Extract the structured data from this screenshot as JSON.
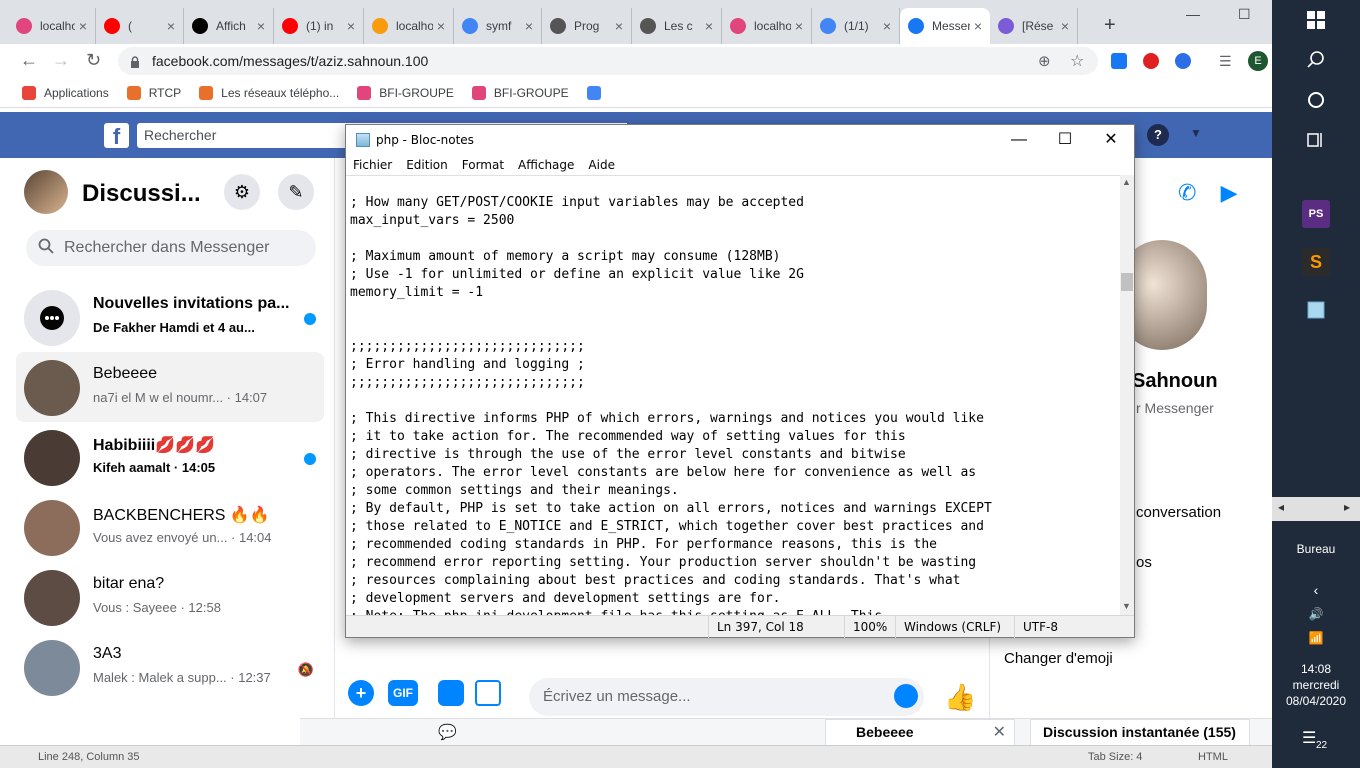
{
  "browser": {
    "tabs": [
      {
        "title": "localhost",
        "icon": "bfi-icon",
        "color": "#e0457b"
      },
      {
        "title": "(",
        "icon": "youtube-icon",
        "color": "#ff0000"
      },
      {
        "title": "Affich",
        "icon": "symfony-icon",
        "color": "#000000"
      },
      {
        "title": "(1) in",
        "icon": "youtube-icon",
        "color": "#ff0000"
      },
      {
        "title": "localhost",
        "icon": "phpmyadmin-icon",
        "color": "#f89c0e"
      },
      {
        "title": "symf",
        "icon": "google-icon",
        "color": "#4285f4"
      },
      {
        "title": "Prog",
        "icon": "w-icon",
        "color": "#555555"
      },
      {
        "title": "Les c",
        "icon": "globe-icon",
        "color": "#555555"
      },
      {
        "title": "localhost",
        "icon": "bfi-icon",
        "color": "#e0457b"
      },
      {
        "title": "(1/1)",
        "icon": "google-icon",
        "color": "#4285f4"
      },
      {
        "title": "Messenger",
        "icon": "facebook-icon",
        "color": "#1877f2"
      },
      {
        "title": "[Rése",
        "icon": "discord-icon",
        "color": "#7b5cd6"
      }
    ],
    "url": "facebook.com/messages/t/aziz.sahnoun.100",
    "profile_letter": "E",
    "bookmarks": [
      {
        "label": "Applications",
        "color": "#e8453c"
      },
      {
        "label": "RTCP",
        "color": "#e8702a"
      },
      {
        "label": "Les réseaux télépho...",
        "color": "#e8702a"
      },
      {
        "label": "BFI-GROUPE",
        "color": "#e0457b"
      },
      {
        "label": "BFI-GROUPE",
        "color": "#e0457b"
      },
      {
        "label": "",
        "color": "#4285f4"
      }
    ]
  },
  "facebook": {
    "search_placeholder": "Rechercher",
    "brand_color": "#4267b2"
  },
  "messenger": {
    "title": "Discussi...",
    "search_placeholder": "Rechercher dans Messenger",
    "conversations": [
      {
        "name": "Nouvelles invitations pa...",
        "snippet": "De Fakher Hamdi et 4 au...",
        "unread": true
      },
      {
        "name": "Bebeeee",
        "snippet": "na7i el M w el noumr...  · 14:07",
        "selected": true
      },
      {
        "name": "Habibiiii💋💋💋",
        "snippet": "Kifeh aamalt  · 14:05",
        "unread": true
      },
      {
        "name": "BACKBENCHERS 🔥🔥",
        "snippet": "Vous avez envoyé un...  · 14:04"
      },
      {
        "name": "bitar ena?",
        "snippet": "Vous : Sayeee  · 12:58"
      },
      {
        "name": "3A3",
        "snippet": "Malek : Malek a supp...  · 12:37",
        "muted": true
      }
    ],
    "composer_placeholder": "Écrivez un message...",
    "composer_gif": "GIF",
    "right_panel": {
      "name": "Sahnoun",
      "subtitle": "r Messenger",
      "conversation_option": "conversation",
      "other_option": "os",
      "emoji_option": "Changer d'emoji"
    }
  },
  "chat_dock": {
    "contact": "Bebeeee",
    "instant": "Discussion instantanée (155)"
  },
  "notepad": {
    "title": "php - Bloc-notes",
    "menu": [
      "Fichier",
      "Edition",
      "Format",
      "Affichage",
      "Aide"
    ],
    "content": "; How many GET/POST/COOKIE input variables may be accepted\nmax_input_vars = 2500\n\n; Maximum amount of memory a script may consume (128MB)\n; Use -1 for unlimited or define an explicit value like 2G\nmemory_limit = -1\n\n\n;;;;;;;;;;;;;;;;;;;;;;;;;;;;;;\n; Error handling and logging ;\n;;;;;;;;;;;;;;;;;;;;;;;;;;;;;;\n\n; This directive informs PHP of which errors, warnings and notices you would like\n; it to take action for. The recommended way of setting values for this\n; directive is through the use of the error level constants and bitwise\n; operators. The error level constants are below here for convenience as well as\n; some common settings and their meanings.\n; By default, PHP is set to take action on all errors, notices and warnings EXCEPT\n; those related to E_NOTICE and E_STRICT, which together cover best practices and\n; recommended coding standards in PHP. For performance reasons, this is the\n; recommend error reporting setting. Your production server shouldn't be wasting\n; resources complaining about best practices and coding standards. That's what\n; development servers and development settings are for.\n; Note: The php.ini-development file has this setting as E_ALL. This",
    "status": {
      "position": "Ln 397, Col 18",
      "zoom": "100%",
      "line_ending": "Windows (CRLF)",
      "encoding": "UTF-8"
    }
  },
  "editor_statusbar": {
    "position": "Line 248, Column 35",
    "tab_size": "Tab Size: 4",
    "language": "HTML"
  },
  "taskbar": {
    "desktop_label": "Bureau",
    "time": "14:08",
    "day": "mercredi",
    "date": "08/04/2020",
    "notifications": "22"
  }
}
